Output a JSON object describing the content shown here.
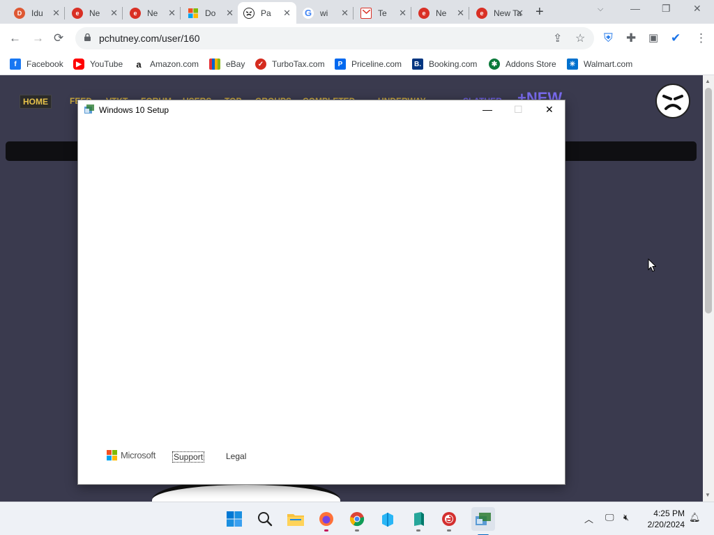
{
  "browser": {
    "tabs": [
      {
        "title": "Idu",
        "icon": "duckduckgo-icon",
        "color": "#de5833"
      },
      {
        "title": "Ne",
        "icon": "pchutney-icon",
        "color": "#d93025"
      },
      {
        "title": "Ne",
        "icon": "pchutney-icon",
        "color": "#d93025"
      },
      {
        "title": "Do",
        "icon": "microsoft-icon",
        "color": "#f25022"
      },
      {
        "title": "Pa",
        "icon": "mascot-icon",
        "color": "#222222"
      },
      {
        "title": "wi",
        "icon": "google-icon",
        "color": "#4285f4"
      },
      {
        "title": "Te",
        "icon": "mail-icon",
        "color": "#d93025"
      },
      {
        "title": "Ne",
        "icon": "pchutney-icon",
        "color": "#d93025"
      },
      {
        "title": "New Tal",
        "icon": "pchutney-icon",
        "color": "#d93025"
      }
    ],
    "url": "pchutney.com/user/160",
    "bookmarks": [
      {
        "label": "Facebook",
        "icon": "facebook-icon",
        "color": "#1877f2"
      },
      {
        "label": "YouTube",
        "icon": "youtube-icon",
        "color": "#ff0000"
      },
      {
        "label": "Amazon.com",
        "icon": "amazon-icon",
        "color": "#111111"
      },
      {
        "label": "eBay",
        "icon": "ebay-icon",
        "color": "#e53238"
      },
      {
        "label": "TurboTax.com",
        "icon": "turbotax-icon",
        "color": "#d52b1e"
      },
      {
        "label": "Priceline.com",
        "icon": "priceline-icon",
        "color": "#0068ef"
      },
      {
        "label": "Booking.com",
        "icon": "booking-icon",
        "color": "#003580"
      },
      {
        "label": "Addons Store",
        "icon": "addons-icon",
        "color": "#0b7a3b"
      },
      {
        "label": "Walmart.com",
        "icon": "walmart-icon",
        "color": "#0071ce"
      }
    ]
  },
  "site": {
    "nav": [
      "HOME",
      "FEED",
      "VTKT",
      "FORUM",
      "USERS",
      "TOP",
      "GROUPS",
      "COMPLETED",
      "UNDERWAY",
      "SLATHER",
      "+NEW"
    ]
  },
  "setup_window": {
    "title": "Windows 10 Setup",
    "brand": "Microsoft",
    "support_link": "Support",
    "legal_link": "Legal"
  },
  "taskbar": {
    "apps": [
      {
        "name": "start-icon"
      },
      {
        "name": "search-icon"
      },
      {
        "name": "file-explorer-icon"
      },
      {
        "name": "firefox-icon"
      },
      {
        "name": "chrome-icon"
      },
      {
        "name": "app-blue-icon"
      },
      {
        "name": "app-teal-icon"
      },
      {
        "name": "pchutney-app-icon"
      },
      {
        "name": "windows-setup-icon"
      }
    ],
    "time": "4:25 PM",
    "date": "2/20/2024"
  },
  "colors": {
    "page_bg": "#3a3a4e",
    "accent": "#0067c0"
  }
}
